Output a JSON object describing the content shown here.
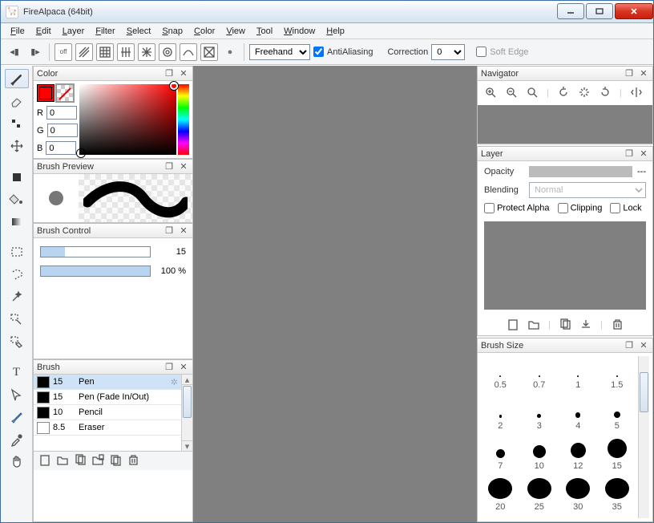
{
  "window": {
    "title": "FireAlpaca (64bit)"
  },
  "menu": [
    "File",
    "Edit",
    "Layer",
    "Filter",
    "Select",
    "Snap",
    "Color",
    "View",
    "Tool",
    "Window",
    "Help"
  ],
  "toolbar": {
    "draw_mode": "Freehand",
    "antialias_label": "AntiAliasing",
    "correction_label": "Correction",
    "correction_value": "0",
    "softedge_label": "Soft Edge"
  },
  "panels": {
    "color": {
      "title": "Color",
      "r_label": "R",
      "r_value": "0",
      "g_label": "G",
      "g_value": "0",
      "b_label": "B",
      "b_value": "0"
    },
    "brush_preview": {
      "title": "Brush Preview"
    },
    "brush_control": {
      "title": "Brush Control",
      "size_value": "15",
      "opacity_value": "100 %"
    },
    "brush": {
      "title": "Brush",
      "items": [
        {
          "size": "15",
          "name": "Pen",
          "fill": "#000"
        },
        {
          "size": "15",
          "name": "Pen (Fade In/Out)",
          "fill": "#000"
        },
        {
          "size": "10",
          "name": "Pencil",
          "fill": "#000"
        },
        {
          "size": "8.5",
          "name": "Eraser",
          "fill": "#fff"
        }
      ]
    },
    "navigator": {
      "title": "Navigator"
    },
    "layer": {
      "title": "Layer",
      "opacity_label": "Opacity",
      "opacity_dash": "---",
      "blending_label": "Blending",
      "blending_value": "Normal",
      "protect_label": "Protect Alpha",
      "clip_label": "Clipping",
      "lock_label": "Lock"
    },
    "brush_size": {
      "title": "Brush Size",
      "sizes": [
        0.5,
        0.7,
        1,
        1.5,
        2,
        3,
        4,
        5,
        7,
        10,
        12,
        15,
        20,
        25,
        30,
        35
      ]
    }
  }
}
